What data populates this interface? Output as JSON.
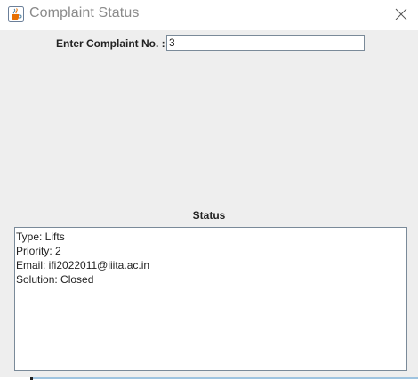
{
  "window": {
    "title": "Complaint Status",
    "app_icon": "java-coffee-cup-icon",
    "close_icon": "close-icon"
  },
  "form": {
    "complaint_label": "Enter Complaint No. :",
    "complaint_value": "3"
  },
  "status": {
    "heading": "Status",
    "lines": [
      "Type: Lifts",
      "Priority: 2",
      "Email: ifi2022011@iiita.ac.in",
      "Solution: Closed"
    ]
  },
  "colors": {
    "window_bg": "#eeeeee",
    "titlebar_bg": "#ffffff",
    "field_border": "#7a8a99",
    "title_text": "#8a8a8a"
  }
}
